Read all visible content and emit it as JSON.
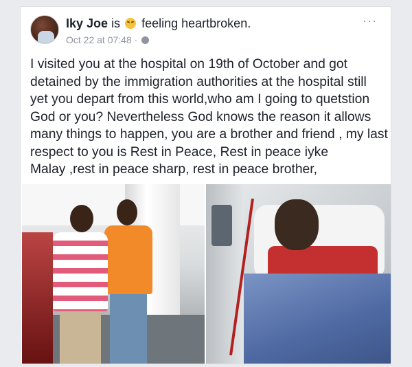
{
  "post": {
    "author": "Iky Joe",
    "status_prefix": "is",
    "feeling_icon": "sad-face-emoji",
    "feeling_text": "feeling heartbroken.",
    "timestamp": "Oct 22 at 07:48 ·",
    "privacy_icon": "globe-icon",
    "more_label": "···",
    "text_lines": [
      "I visited you at the hospital on 19th of October and got",
      "detained by the immigration authorities at the hospital  still",
      "yet you depart from this world,who am I going to quetstion",
      "God or you? Nevertheless God knows the reason it allows",
      "many things to happen, you are a brother and friend , my last",
      "respect to you is Rest in Peace, Rest in peace iyke",
      "Malay ,rest in peace sharp, rest in peace brother,"
    ]
  },
  "photos": [
    {
      "icon": "photo-two-men-airport"
    },
    {
      "icon": "photo-man-hospital-bed"
    }
  ],
  "colors": {
    "page_bg": "#e9ebee",
    "card_bg": "#ffffff",
    "text": "#1d2129",
    "meta": "#90949c"
  }
}
